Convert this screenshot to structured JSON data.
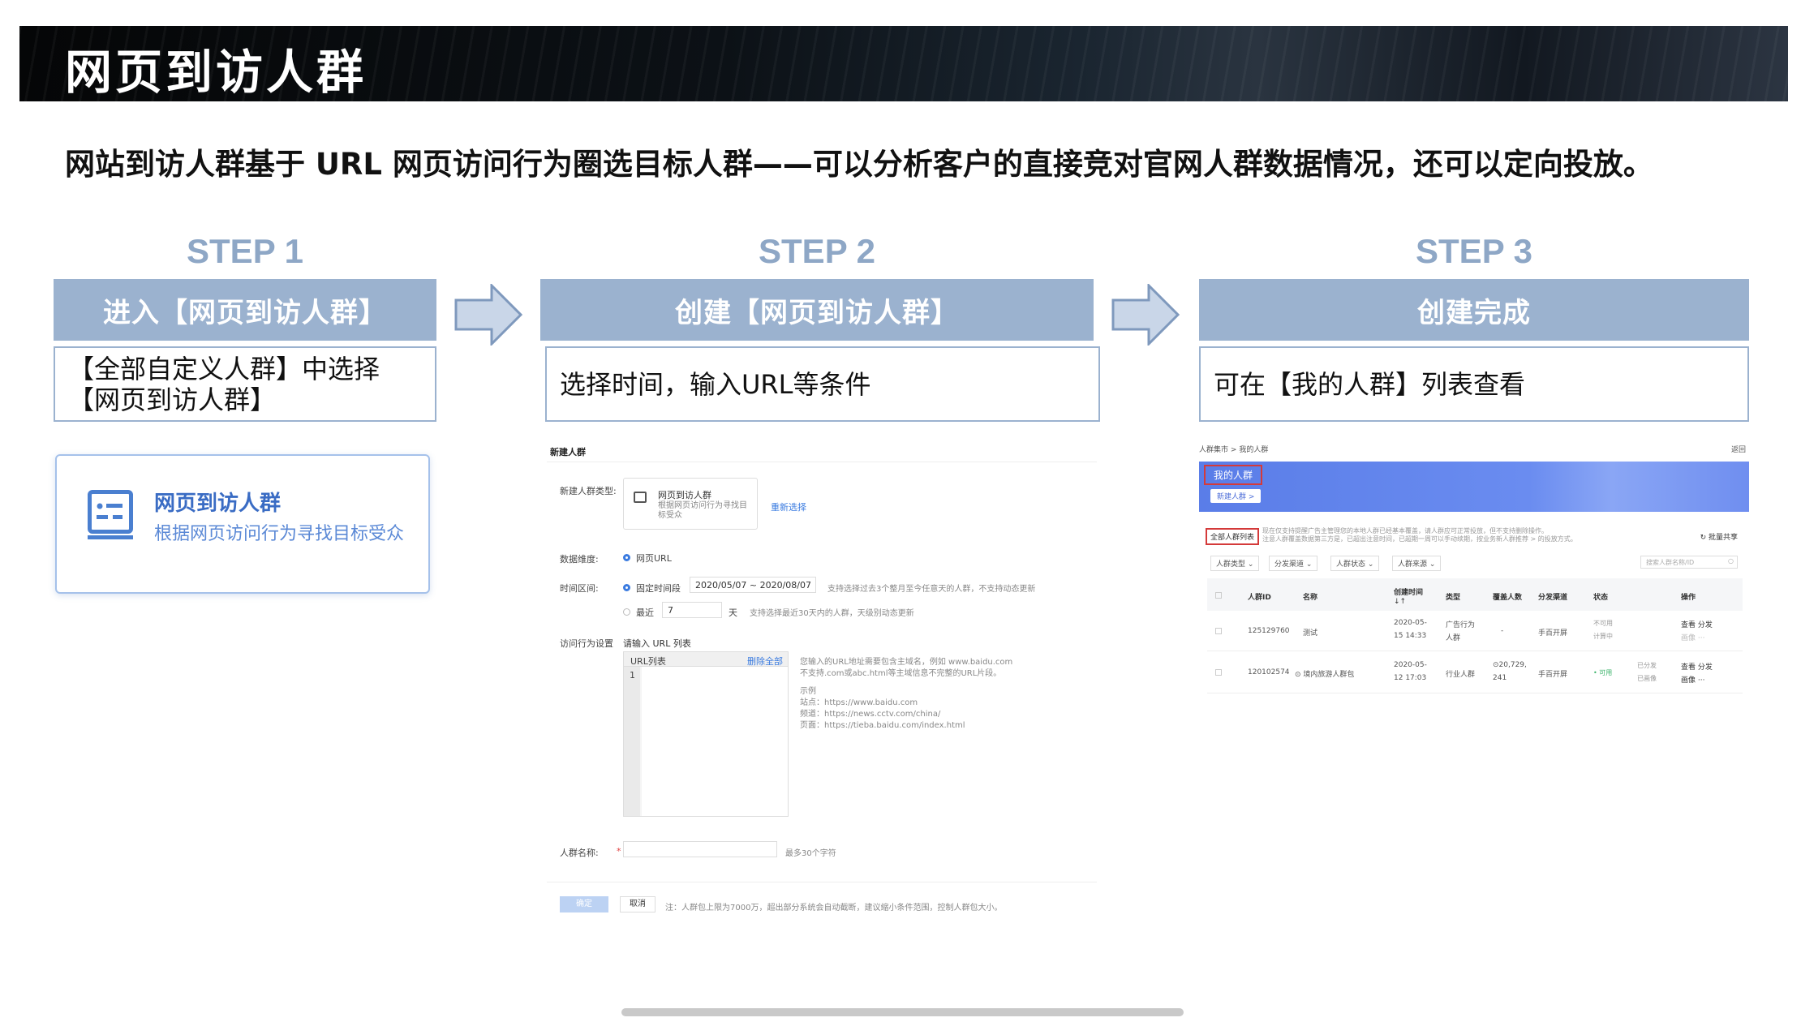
{
  "banner": {
    "title": "网页到访人群"
  },
  "subtitle": "网站到访人群基于 URL 网页访问行为圈选目标人群——可以分析客户的直接竞对官网人群数据情况，还可以定向投放。",
  "steps": [
    {
      "label": "STEP 1",
      "title": "进入【网页到访人群】",
      "desc": "【全部自定义人群】中选择【网页到访人群】"
    },
    {
      "label": "STEP 2",
      "title": "创建【网页到访人群】",
      "desc": "选择时间，输入URL等条件"
    },
    {
      "label": "STEP 3",
      "title": "创建完成",
      "desc": "可在【我的人群】列表查看"
    }
  ],
  "card": {
    "icon": "audience-card-icon",
    "title": "网页到访人群",
    "subtitle": "根据网页访问行为寻找目标受众"
  },
  "form": {
    "heading": "新建人群",
    "type_label": "新建人群类型:",
    "type_name": "网页到访人群",
    "type_desc": "根据网页访问行为寻找目标受众",
    "reselect": "重新选择",
    "dimension_label": "数据维度:",
    "dimension_value": "网页URL",
    "range_label": "时间区间:",
    "fixed_label": "固定时间段",
    "date_range": "2020/05/07 ~ 2020/08/07",
    "fixed_note": "支持选择过去3个整月至今任意天的人群，不支持动态更新",
    "recent_label": "最近",
    "recent_value": "7",
    "recent_unit": "天",
    "recent_note": "支持选择最近30天内的人群，天级别动态更新",
    "behavior_label": "访问行为设置",
    "behavior_hint": "请输入 URL 列表",
    "url_list_header": "URL列表",
    "delete_all": "删除全部",
    "line_no": "1",
    "url_note_1": "您输入的URL地址需要包含主域名，例如 www.baidu.com",
    "url_note_2": "不支持.com或abc.html等主域信息不完整的URL片段。",
    "example_title": "示例",
    "example_site": "站点：https://www.baidu.com",
    "example_channel": "频道：https://news.cctv.com/china/",
    "example_page": "页面：https://tieba.baidu.com/index.html",
    "name_label": "人群名称:",
    "name_limit": "最多30个字符",
    "confirm": "确定",
    "cancel": "取消",
    "footer_note": "注：人群包上限为7000万，超出部分系统会自动截断，建议缩小条件范围，控制人群包大小。"
  },
  "list": {
    "breadcrumb_1": "人群集市",
    "breadcrumb_sep": ">",
    "breadcrumb_2": "我的人群",
    "back": "返回",
    "hero_title": "我的人群",
    "new_button": "新建人群 >",
    "tab_all": "全部人群列表",
    "notice_1": "现在仅支持提醒广告主管理您的本地人群已经基本覆盖，请人群应可正常投放，但不支持删除操作。",
    "notice_2": "注意人群覆盖数据第三方是，已超出注意时间，已超期一周可以手动续期，按业务新人群推荐 > 的投放方式。",
    "batch_share": "批量共享",
    "filters": [
      "人群类型",
      "分发渠道",
      "人群状态",
      "人群来源"
    ],
    "search_placeholder": "搜索人群名称/ID",
    "columns": [
      "人群ID",
      "名称",
      "创建时间",
      "类型",
      "覆盖人数",
      "分发渠道",
      "状态",
      "操作"
    ],
    "sort_hint": "↓↑",
    "rows": [
      {
        "id": "125129760",
        "name": "测试",
        "time_1": "2020-05-",
        "time_2": "15 14:33",
        "type_1": "广告行为",
        "type_2": "人群",
        "count_1": "-",
        "count_2": "",
        "channel": "手百开屏",
        "status_1": "不可用",
        "status_2": "计算中",
        "ops_1": "查看 分发",
        "ops_2": "画像 ···"
      },
      {
        "id": "120102574",
        "name": "境内旅游人群包",
        "time_1": "2020-05-",
        "time_2": "12 17:03",
        "type_1": "行业人群",
        "type_2": "",
        "count_1": "20,729,",
        "count_2": "241",
        "channel": "手百开屏",
        "status_1": "• 可用",
        "status_2": "",
        "status_3": "已分发",
        "status_4": "已画像",
        "ops_1": "查看 分发",
        "ops_2": "画像 ···"
      }
    ]
  },
  "colors": {
    "step_head": "#9bb2cf",
    "step_label": "#8ea7c6",
    "card_blue": "#3a6cc4",
    "hero": "#5a7de8"
  }
}
